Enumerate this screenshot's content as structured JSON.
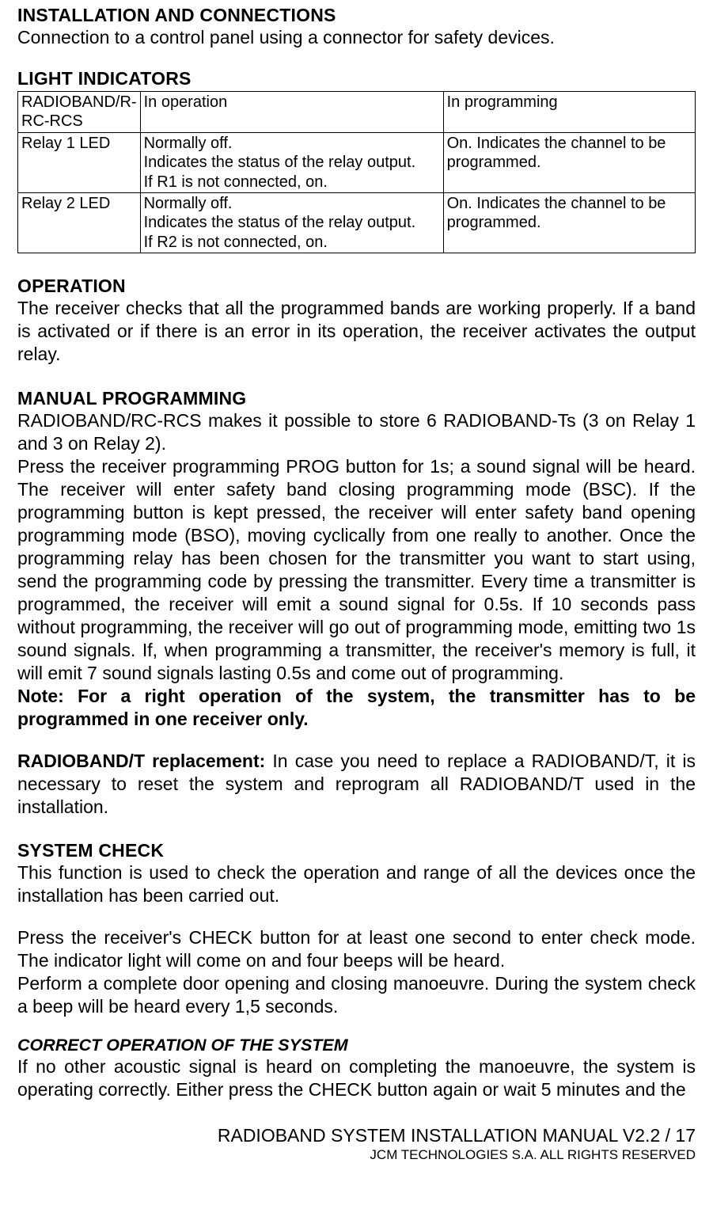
{
  "headings": {
    "installation": "INSTALLATION AND CONNECTIONS",
    "light_indicators": "LIGHT INDICATORS",
    "operation": "OPERATION",
    "manual_programming": "MANUAL PROGRAMMING",
    "system_check": "SYSTEM CHECK",
    "correct_operation": "CORRECT OPERATION OF THE SYSTEM"
  },
  "installation": {
    "text": "Connection to a control panel using a connector for safety devices."
  },
  "table": {
    "rows": [
      {
        "c0": "RADIOBAND/R-RC-RCS",
        "c1": "In operation",
        "c2": "In programming"
      },
      {
        "c0": "Relay 1 LED",
        "c1": "Normally off.\nIndicates the status of the relay output.\nIf R1 is not connected, on.",
        "c2": "On. Indicates the channel to be programmed."
      },
      {
        "c0": "Relay 2 LED",
        "c1": "Normally off.\nIndicates the status of the relay output.\nIf R2 is not connected, on.",
        "c2": "On. Indicates the channel to be programmed."
      }
    ]
  },
  "operation": {
    "text": "The receiver checks that all the programmed bands are working properly. If a band is activated or if there is an error in its operation, the receiver activates the output relay."
  },
  "manual_programming": {
    "p1": "RADIOBAND/RC-RCS makes it possible to store 6 RADIOBAND-Ts (3 on Relay 1 and 3 on Relay 2).",
    "p2": "Press the receiver programming PROG button for 1s; a sound signal will be heard. The receiver will enter safety band closing programming mode (BSC). If the programming button is kept pressed, the receiver will enter  safety band opening programming mode (BSO), moving cyclically from one really to another. Once the programming relay has been chosen for the transmitter you want to start using, send the programming code by pressing the transmitter. Every time a transmitter is programmed, the receiver will emit a sound signal for 0.5s. If 10 seconds pass without programming, the receiver will go out of programming mode, emitting two 1s sound signals. If, when programming a transmitter, the receiver's memory is full, it will emit 7 sound signals lasting 0.5s and come out of programming.",
    "note": "Note: For a right operation of the system, the transmitter has to be programmed in one receiver only.",
    "replacement_label": "RADIOBAND/T replacement:",
    "replacement_text": " In case you need to replace a RADIOBAND/T, it is necessary to reset the system and reprogram all RADIOBAND/T used in the installation."
  },
  "system_check": {
    "p1": "This function is used to check the operation and range of all the devices once the installation has been carried out.",
    "p2": "Press the receiver's CHECK button for at least one second to enter check mode. The indicator light will come on and four beeps will be heard.",
    "p3": "Perform a complete door opening and closing manoeuvre.  During the system check a beep will be heard every 1,5 seconds."
  },
  "correct_operation": {
    "text": "If no other acoustic signal is heard on completing the manoeuvre, the system is operating correctly. Either press the CHECK button again or wait 5 minutes and the"
  },
  "footer": {
    "title": "RADIOBAND SYSTEM INSTALLATION MANUAL V2.2 / 17",
    "sub": "JCM TECHNOLOGIES S.A. ALL RIGHTS RESERVED"
  }
}
